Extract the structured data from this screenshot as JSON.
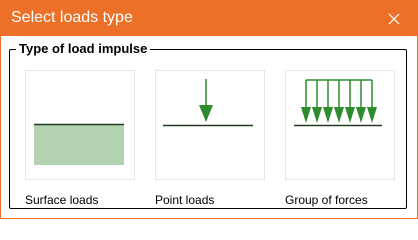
{
  "dialog": {
    "title": "Select loads type",
    "close_icon": "close-icon"
  },
  "group": {
    "legend": "Type of load impulse"
  },
  "options": [
    {
      "label": "Surface loads",
      "icon": "surface-loads-icon"
    },
    {
      "label": "Point loads",
      "icon": "point-load-icon"
    },
    {
      "label": "Group of forces",
      "icon": "group-of-forces-icon"
    }
  ],
  "colors": {
    "accent": "#ED7029",
    "title_text": "#FFFFFF",
    "surface_fill": "#B2D2B1",
    "arrow_green": "#2E8B2E",
    "line_dark": "#1F3A1F"
  }
}
